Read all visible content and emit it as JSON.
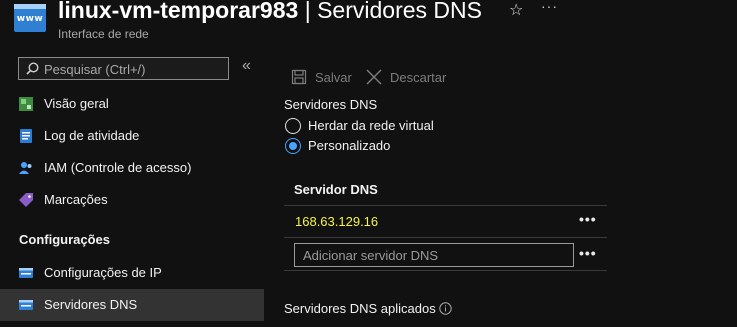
{
  "header": {
    "resource_icon_text": "www",
    "resource_name": "linux-vm-temporar983",
    "separator": "|",
    "page_name": "Servidores DNS",
    "subtitle": "Interface de rede",
    "star_icon": "star-icon",
    "more_icon": "more-icon",
    "more_label": "···"
  },
  "sidebar": {
    "search_placeholder": "Pesquisar (Ctrl+/)",
    "collapse_label": "«",
    "items": [
      {
        "label": "Visão geral",
        "icon": "overview-icon"
      },
      {
        "label": "Log de atividade",
        "icon": "activity-log-icon"
      },
      {
        "label": "IAM (Controle de acesso)",
        "icon": "iam-icon"
      },
      {
        "label": "Marcações",
        "icon": "tag-icon"
      }
    ],
    "section_title": "Configurações",
    "section_items": [
      {
        "label": "Configurações de IP",
        "icon": "ip-config-icon"
      },
      {
        "label": "Servidores DNS",
        "icon": "dns-icon",
        "active": true
      }
    ]
  },
  "toolbar": {
    "save_label": "Salvar",
    "discard_label": "Descartar"
  },
  "dns": {
    "section_label": "Servidores DNS",
    "options": [
      {
        "label": "Herdar da rede virtual",
        "selected": false
      },
      {
        "label": "Personalizado",
        "selected": true
      }
    ],
    "table_header": "Servidor DNS",
    "servers": [
      "168.63.129.16"
    ],
    "row_more_label": "•••",
    "add_placeholder": "Adicionar servidor DNS",
    "applied_label": "Servidores DNS aplicados"
  },
  "colors": {
    "accent": "#4aa3ff",
    "highlight": "#f5f542",
    "background": "#111111",
    "active_nav": "#333333"
  }
}
